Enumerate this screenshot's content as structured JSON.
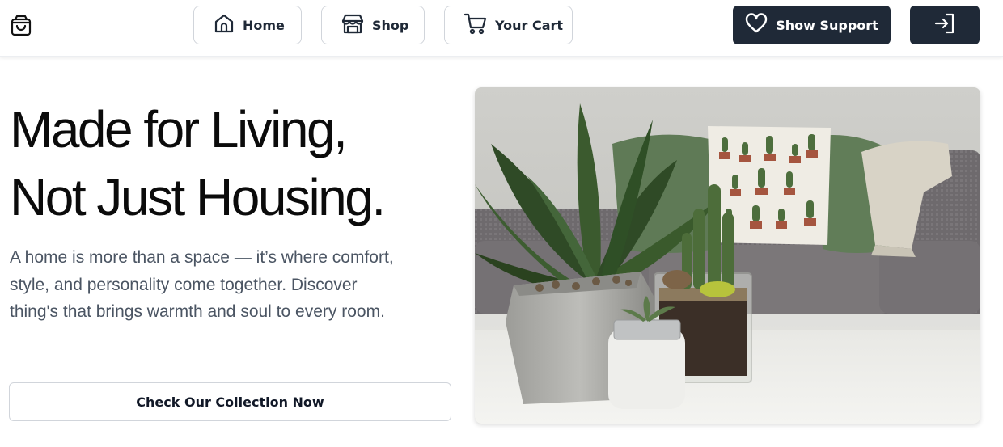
{
  "header": {
    "logo_icon": "shopping-bag-icon",
    "nav": [
      {
        "label": "Home",
        "icon": "home-icon"
      },
      {
        "label": "Shop",
        "icon": "store-icon"
      },
      {
        "label": "Your Cart",
        "icon": "cart-icon"
      }
    ],
    "support_label": "Show Support",
    "support_icon": "heart-icon",
    "login_icon": "login-icon"
  },
  "hero": {
    "title_line1": "Made for Living,",
    "title_line2": "Not Just Housing.",
    "description": "A home is more than a space — it’s where comfort, style, and personality come together. Discover thing's that brings warmth and soul to every room.",
    "cta_label": "Check Our Collection Now",
    "image_subject": "potted plants and succulents on a white table in front of a grey sofa with cactus pillow"
  },
  "colors": {
    "dark_button": "#1f2937",
    "border": "#d1d5db",
    "text": "#111827",
    "muted_text": "#4b5563"
  }
}
